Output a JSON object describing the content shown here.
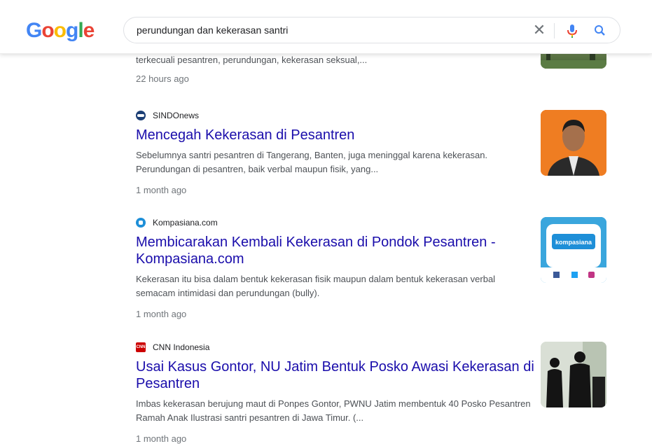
{
  "logo": {
    "g1": "G",
    "o1": "o",
    "o2": "o",
    "g2": "g",
    "l": "l",
    "e": "e"
  },
  "search": {
    "value": "perundungan dan kekerasan santri"
  },
  "icons": {
    "clear": "close-icon",
    "mic": "microphone-icon",
    "search": "search-icon"
  },
  "colors": {
    "link": "#1a0dab",
    "snippet": "#4d5156",
    "time": "#70757a",
    "blue": "#4285f4",
    "red": "#ea4335",
    "yellow": "#fbbc05",
    "green": "#34a853"
  },
  "top_result": {
    "snippet": "Gegap gempita peringatan Hari Santri Nasional menggema hampir di semua sudut ... tak terkecuali pesantren, perundungan, kekerasan seksual,...",
    "time": "22 hours ago"
  },
  "results": [
    {
      "source": "SINDOnews",
      "title": "Mencegah Kekerasan di Pesantren",
      "snippet": "Sebelumnya santri pesantren di Tangerang, Banten, juga meninggal karena kekerasan. Perundungan di pesantren, baik verbal maupun fisik, yang...",
      "time": "1 month ago"
    },
    {
      "source": "Kompasiana.com",
      "title": "Membicarakan Kembali Kekerasan di Pondok Pesantren - Kompasiana.com",
      "snippet": "Kekerasan itu bisa dalam bentuk kekerasan fisik maupun dalam bentuk kekerasan verbal semacam intimidasi dan perundungan (bully).",
      "time": "1 month ago",
      "thumb_text": "kompasiana"
    },
    {
      "source": "CNN Indonesia",
      "title": "Usai Kasus Gontor, NU Jatim Bentuk Posko Awasi Kekerasan di Pesantren",
      "snippet": "Imbas kekerasan berujung maut di Ponpes Gontor, PWNU Jatim membentuk 40 Posko Pesantren Ramah Anak Ilustrasi santri pesantren di Jawa Timur. (...",
      "time": "1 month ago",
      "favicon_text": "CNN"
    }
  ]
}
